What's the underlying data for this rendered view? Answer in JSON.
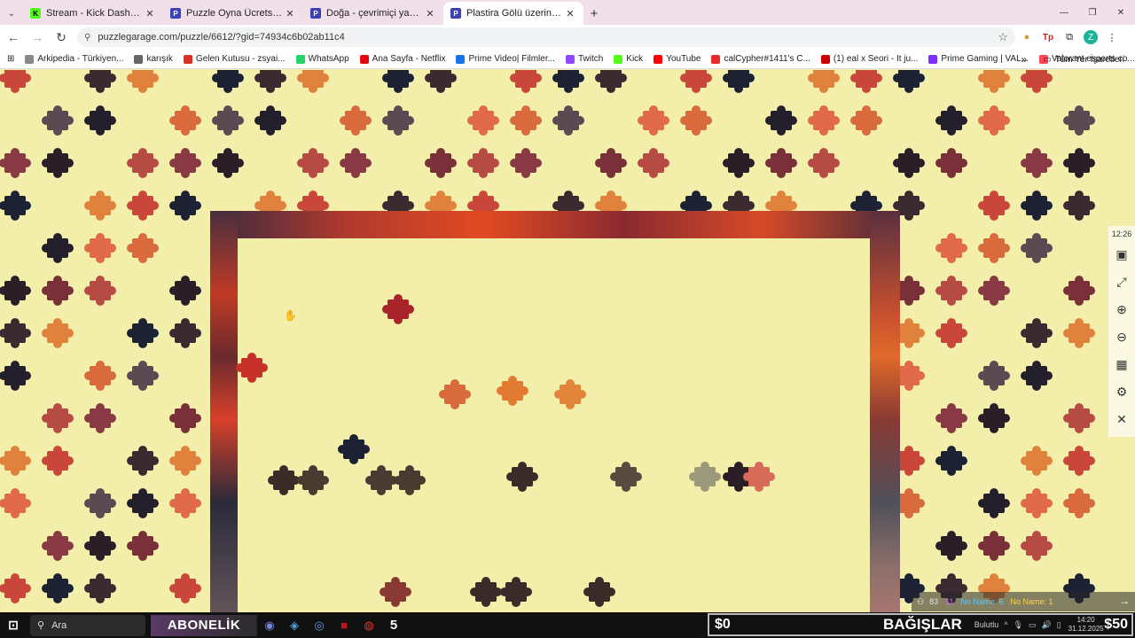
{
  "browser": {
    "tabs": [
      {
        "title": "Stream - Kick Dashboard",
        "favicon": "kick-icon",
        "color": "#53fc18",
        "active": false
      },
      {
        "title": "Puzzle Oyna Ücretsiz - Yetişkinl",
        "favicon": "puzzle-garage-icon",
        "color": "#3b42b8",
        "active": false
      },
      {
        "title": "Doğa - çevrimiçi yapboz koleksi",
        "favicon": "puzzle-garage-icon",
        "color": "#3b42b8",
        "active": false
      },
      {
        "title": "Plastira Gölü üzerinde gün batı",
        "favicon": "puzzle-garage-icon",
        "color": "#3b42b8",
        "active": true
      }
    ],
    "url": "puzzlegarage.com/puzzle/6612/?gid=74934c6b02ab11c4",
    "bookmarks": [
      {
        "label": "Arkipedia - Türkiyen...",
        "color": "#888"
      },
      {
        "label": "karışık",
        "color": "#666"
      },
      {
        "label": "Gelen Kutusu - zsyai...",
        "color": "#d93025"
      },
      {
        "label": "WhatsApp",
        "color": "#25d366"
      },
      {
        "label": "Ana Sayfa - Netflix",
        "color": "#e50914"
      },
      {
        "label": "Prime Video| Filmler...",
        "color": "#1a73e8"
      },
      {
        "label": "Twitch",
        "color": "#9146ff"
      },
      {
        "label": "Kick",
        "color": "#53fc18"
      },
      {
        "label": "YouTube",
        "color": "#ff0000"
      },
      {
        "label": "calCypher#1411's C...",
        "color": "#e52b2b"
      },
      {
        "label": "(1) eal x Seori - It ju...",
        "color": "#cc0000"
      },
      {
        "label": "Prime Gaming | VAL...",
        "color": "#7b2ff7"
      },
      {
        "label": "Valorant esports co...",
        "color": "#ff4655"
      }
    ],
    "bookmarks_more": "»",
    "all_bookmarks": "Tüm Yer İşaretleri"
  },
  "puzzle": {
    "clock": "12:26",
    "players": [
      {
        "label": "83",
        "color": "#e0e0e0"
      },
      {
        "label": "11",
        "color": "#d070ff"
      },
      {
        "label": "No Name: 6",
        "color": "#5ec8ff"
      },
      {
        "label": "No Name: 1",
        "color": "#ffd24a"
      }
    ],
    "tools": [
      {
        "name": "image-preview-icon",
        "glyph": "▣"
      },
      {
        "name": "fullscreen-icon",
        "glyph": "⤢"
      },
      {
        "name": "zoom-in-icon",
        "glyph": "⊕"
      },
      {
        "name": "zoom-out-icon",
        "glyph": "⊖"
      },
      {
        "name": "grid-sort-icon",
        "glyph": "▦"
      },
      {
        "name": "settings-icon",
        "glyph": "⚙"
      },
      {
        "name": "close-icon",
        "glyph": "✕"
      }
    ]
  },
  "taskbar": {
    "search_label": "Ara",
    "banner_label": "ABONELİK",
    "count_label": "5",
    "left_amount": "$0",
    "donate_label": "BAĞIŞLAR",
    "weather": "Bulutlu",
    "time": "14:20",
    "date": "31.12.2025",
    "right_amount": "$50"
  }
}
